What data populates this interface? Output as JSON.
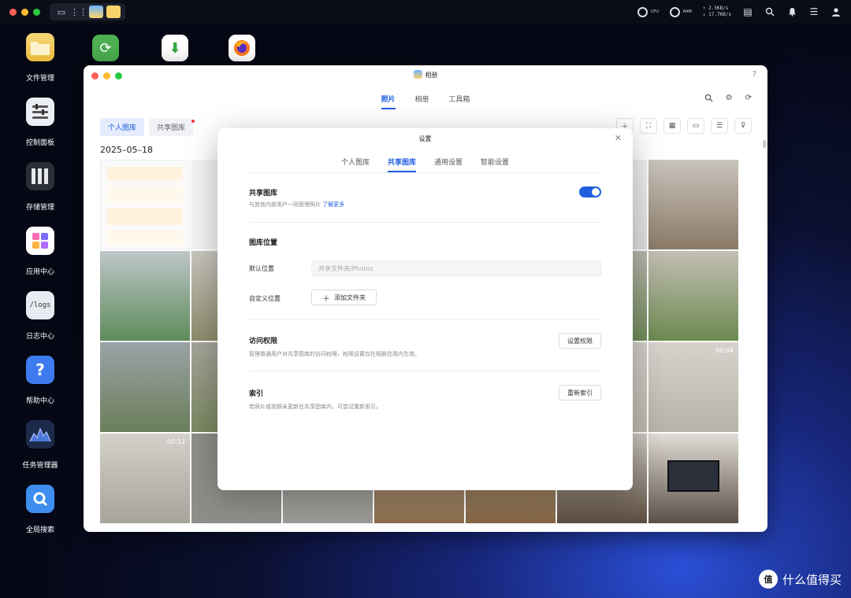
{
  "desktop": {
    "icons": [
      {
        "label": "文件管理",
        "icon": "folder-icon"
      },
      {
        "label": "控制面板",
        "icon": "control-panel-icon"
      },
      {
        "label": "存储管理",
        "icon": "storage-icon"
      },
      {
        "label": "应用中心",
        "icon": "app-center-icon"
      },
      {
        "label": "日志中心",
        "icon": "logs-icon",
        "glyph": "/logs"
      },
      {
        "label": "帮助中心",
        "icon": "help-icon",
        "glyph": "?"
      },
      {
        "label": "任务管理器",
        "icon": "task-manager-icon"
      },
      {
        "label": "全局搜索",
        "icon": "global-search-icon"
      }
    ]
  },
  "sysbar": {
    "cpu_label": "CPU",
    "ram_label": "RAM",
    "net_up": "↑ 2.5KB/s",
    "net_down": "↓ 17.7KB/s"
  },
  "window": {
    "title": "相册",
    "help": "?",
    "tabs": [
      {
        "label": "照片",
        "active": true
      },
      {
        "label": "相册",
        "active": false
      },
      {
        "label": "工具箱",
        "active": false
      }
    ],
    "library_tabs": [
      {
        "label": "个人图库",
        "active": true
      },
      {
        "label": "共享图库",
        "active": false
      }
    ],
    "date_header": "2025–05–18",
    "video_durations": [
      "00:04",
      "00:12"
    ]
  },
  "settings": {
    "title": "设置",
    "tabs": [
      {
        "label": "个人图库",
        "active": false
      },
      {
        "label": "共享图库",
        "active": true
      },
      {
        "label": "通用设置",
        "active": false
      },
      {
        "label": "智能设置",
        "active": false
      }
    ],
    "shared": {
      "heading": "共享图库",
      "desc": "与其他内部用户一同管理照片",
      "learn_more": "了解更多",
      "enabled": true
    },
    "location": {
      "heading": "图库位置",
      "default_label": "默认位置",
      "default_value": "共享文件夹/Photos",
      "custom_label": "自定义位置",
      "add_button": "添加文件夹"
    },
    "access": {
      "heading": "访问权限",
      "desc": "管理普通用户对共享图库的访问权限，权限设置仅在相册应用内生效。",
      "button": "设置权限"
    },
    "index": {
      "heading": "索引",
      "desc": "若照片或视频未更新在共享图库内，可尝试重新索引。",
      "button": "重新索引"
    }
  },
  "watermark": "什么值得买",
  "colors": {
    "accent": "#1f5fe0",
    "close": "#ff5f57",
    "minimize": "#febc2e",
    "maximize": "#28c840"
  }
}
